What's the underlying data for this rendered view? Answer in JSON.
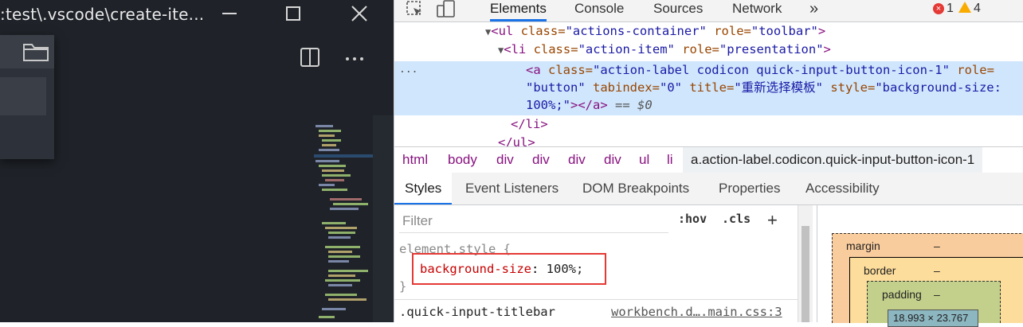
{
  "vscode": {
    "title": ":test\\.vscode\\create-ite...",
    "min_icon": "minimize-icon",
    "max_icon": "maximize-icon",
    "close_icon": "close-icon",
    "folder_icon": "folder-icon",
    "split_icon": "split-editor-icon",
    "more_icon": "more-actions-icon"
  },
  "devtools": {
    "tabs": [
      "Elements",
      "Console",
      "Sources",
      "Network"
    ],
    "more_tabs": "»",
    "errors": "1",
    "warnings": "4",
    "dom": {
      "line1_tag_open": "<ul ",
      "line1_attr1": "class=",
      "line1_val1": "\"actions-container\"",
      "line1_attr2": " role=",
      "line1_val2": "\"toolbar\"",
      "line1_close": ">",
      "line2_tag_open": "<li ",
      "line2_attr1": "class=",
      "line2_val1": "\"action-item\"",
      "line2_attr2": " role=",
      "line2_val2": "\"presentation\"",
      "line2_close": ">",
      "line3_tag_open": "<a ",
      "line3_attr1": "class=",
      "line3_val1": "\"action-label codicon quick-input-button-icon-1\"",
      "line3_attr2": " role=",
      "line4_val2": "\"button\"",
      "line4_attr3": " tabindex=",
      "line4_val3": "\"0\"",
      "line4_attr4": " title=",
      "line4_val4": "\"重新选择模板\"",
      "line4_attr5": " style=",
      "line4_val5": "\"background-size:",
      "line5_val5": "100%;\"",
      "line5_close": "></a>",
      "line5_eq": " == $0",
      "line6": "</li>",
      "line7": "</ul>",
      "ellipsis": "..."
    },
    "breadcrumbs": [
      "html",
      "body",
      "div",
      "div",
      "div",
      "div",
      "ul",
      "li",
      "a.action-label.codicon.quick-input-button-icon-1"
    ],
    "subtabs": [
      "Styles",
      "Event Listeners",
      "DOM Breakpoints",
      "Properties",
      "Accessibility"
    ],
    "filter_placeholder": "Filter",
    "hov": ":hov",
    "cls": ".cls",
    "plus": "+",
    "element_style": "element.style {",
    "prop_name": "background-size",
    "prop_colon": ": ",
    "prop_value": "100%;",
    "close_brace": "}",
    "rule_selector": ".quick-input-titlebar",
    "rule_source": "workbench.d….main.css:3",
    "box_model": {
      "margin": "margin",
      "margin_val": "–",
      "border": "border",
      "border_val": "–",
      "padding": "padding",
      "padding_val": "–",
      "content": "18.993 × 23.767"
    }
  }
}
